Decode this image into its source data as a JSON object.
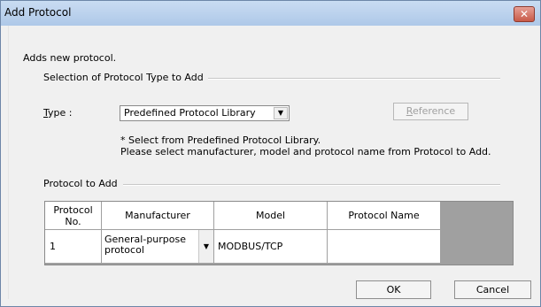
{
  "window": {
    "title": "Add Protocol",
    "close_glyph": "✕"
  },
  "intro": "Adds new protocol.",
  "selection": {
    "title": "Selection of Protocol Type to Add"
  },
  "type": {
    "label_prefix": "T",
    "label_rest": "ype :",
    "selected": "Predefined Protocol Library",
    "reference_prefix": "R",
    "reference_rest": "eference"
  },
  "notes": {
    "line1": "* Select from Predefined Protocol Library.",
    "line2": "Please select manufacturer, model and protocol name from Protocol to Add."
  },
  "protocol_to_add": {
    "title": "Protocol to Add",
    "headers": {
      "no_line1": "Protocol",
      "no_line2": "No.",
      "manufacturer": "Manufacturer",
      "model": "Model",
      "protocol_name": "Protocol Name"
    },
    "rows": [
      {
        "no": "1",
        "manufacturer_line1": "General-purpose",
        "manufacturer_line2": "protocol",
        "model": "MODBUS/TCP",
        "protocol_name": ""
      }
    ]
  },
  "buttons": {
    "ok": "OK",
    "cancel": "Cancel"
  }
}
